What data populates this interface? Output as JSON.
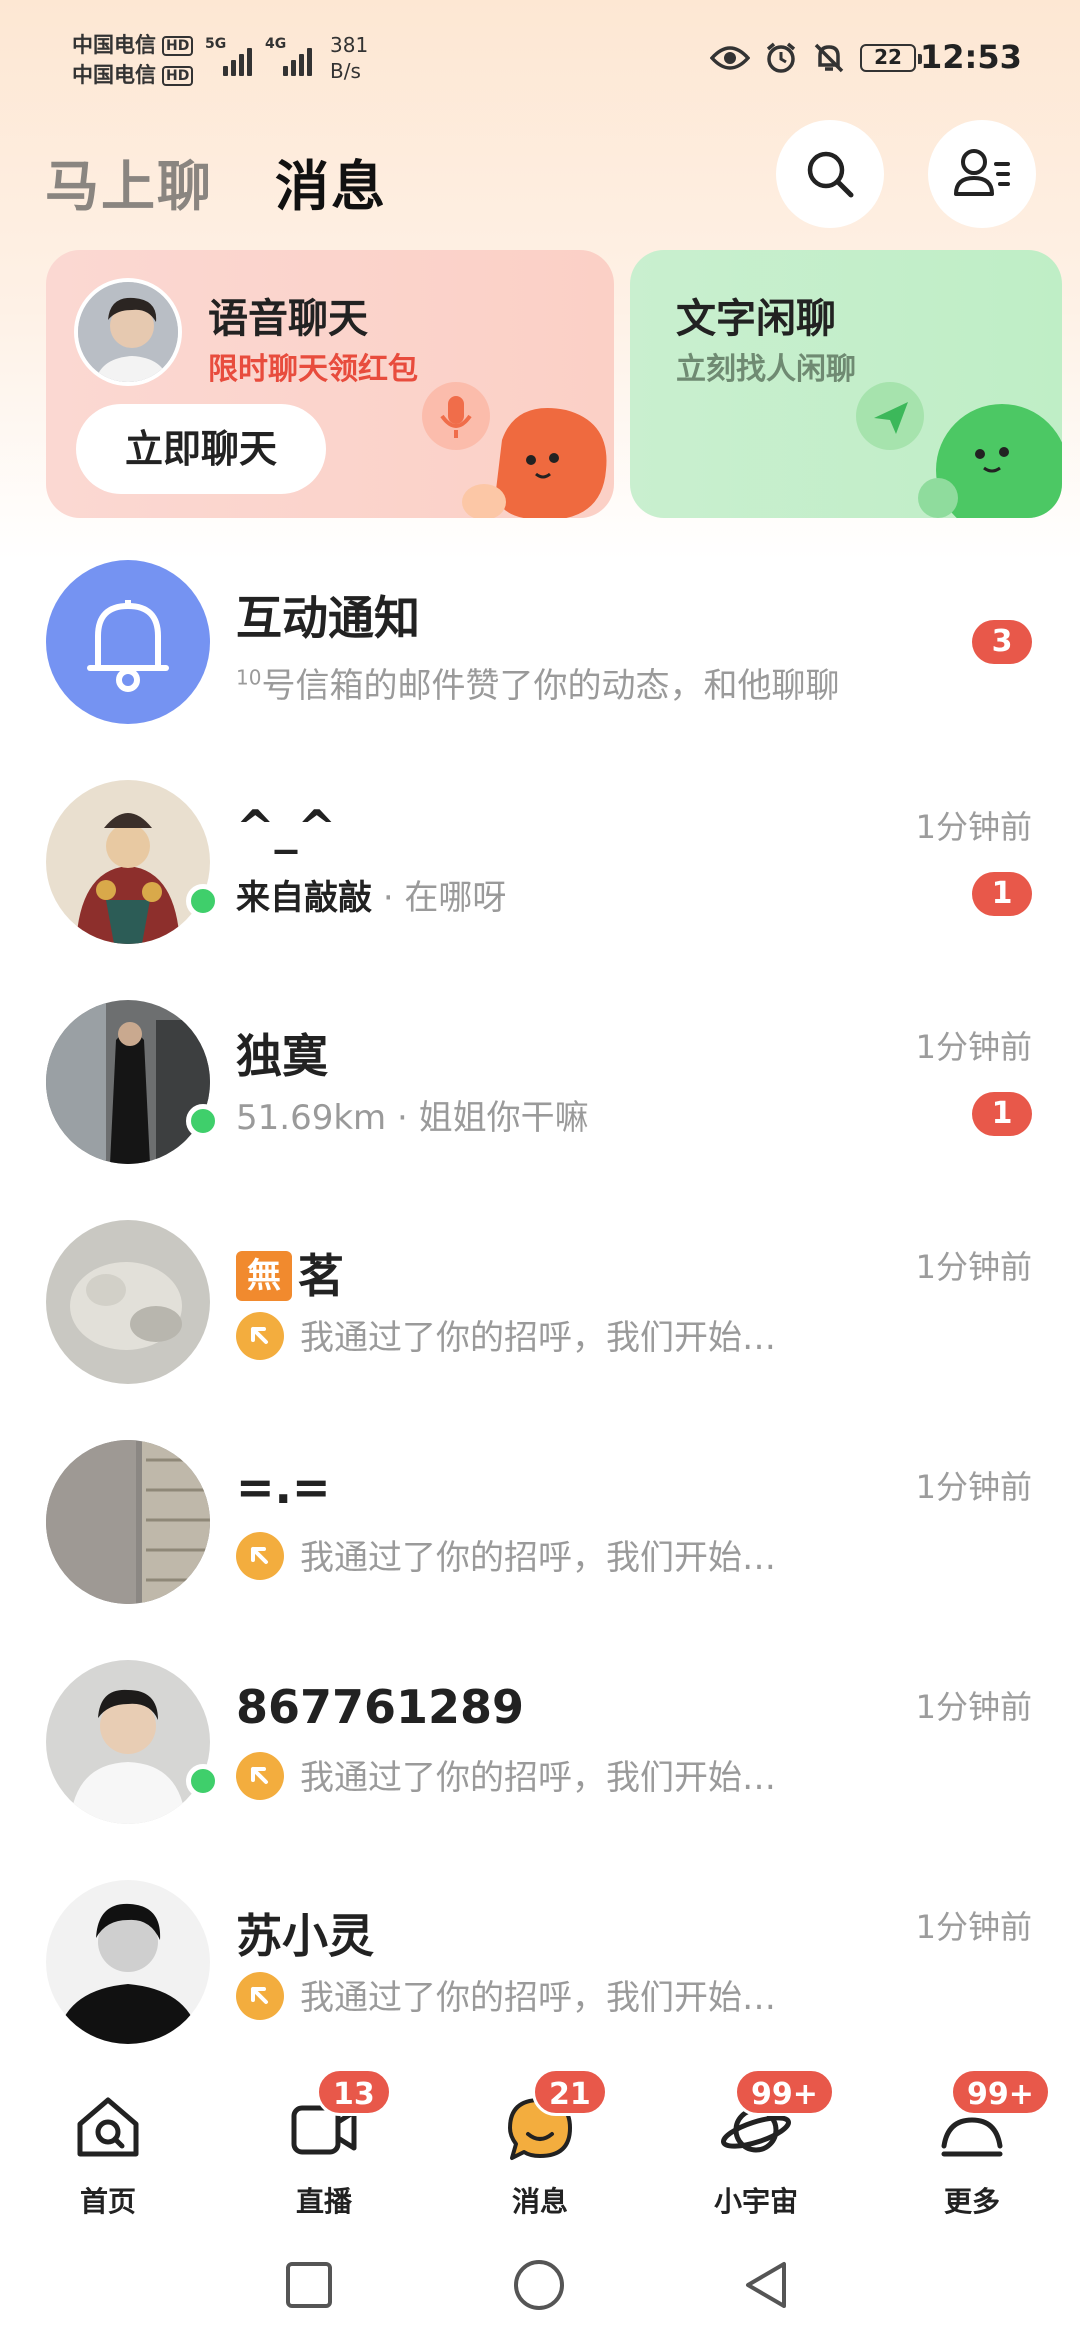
{
  "status_bar": {
    "carrier_1": "中国电信",
    "carrier_2": "中国电信",
    "hd": "HD",
    "sig1": "5G",
    "sig2": "4G",
    "speed_value": "381",
    "speed_unit": "B/s",
    "battery": "22",
    "time": "12:53"
  },
  "header": {
    "tab_inactive": "马上聊",
    "tab_active": "消息"
  },
  "cards": {
    "voice": {
      "title": "语音聊天",
      "subtitle": "限时聊天领红包",
      "button": "立即聊天"
    },
    "text": {
      "title": "文字闲聊",
      "subtitle": "立刻找人闲聊"
    }
  },
  "notification": {
    "title": "互动通知",
    "prefix": "10",
    "text": "号信箱的邮件赞了你的动态，和他聊聊",
    "badge": "3"
  },
  "messages": [
    {
      "name": "^_^",
      "from": "来自敲敲",
      "text": "· 在哪呀",
      "time": "1分钟前",
      "badge": "1"
    },
    {
      "name": "独寞",
      "from": "",
      "text": "51.69km · 姐姐你干嘛",
      "time": "1分钟前",
      "badge": "1"
    },
    {
      "name": "茗",
      "name_icon": "無",
      "text": "我通过了你的招呼，我们开始…",
      "time": "1分钟前"
    },
    {
      "name": "=.=",
      "text": "我通过了你的招呼，我们开始…",
      "time": "1分钟前"
    },
    {
      "name": "867761289",
      "text": "我通过了你的招呼，我们开始…",
      "time": "1分钟前"
    },
    {
      "name": "苏小灵",
      "text": "我通过了你的招呼，我们开始…",
      "time": "1分钟前"
    }
  ],
  "nav": [
    {
      "label": "首页",
      "badge": ""
    },
    {
      "label": "直播",
      "badge": "13"
    },
    {
      "label": "消息",
      "badge": "21"
    },
    {
      "label": "小宇宙",
      "badge": "99+"
    },
    {
      "label": "更多",
      "badge": "99+"
    }
  ],
  "colors": {
    "accent_orange": "#f3ad3e",
    "badge_red": "#e8584a",
    "voice_card": "#fbd4cb",
    "text_card": "#c5eecb",
    "bell_circle": "#7593f2",
    "online_green": "#3fcf6b"
  }
}
